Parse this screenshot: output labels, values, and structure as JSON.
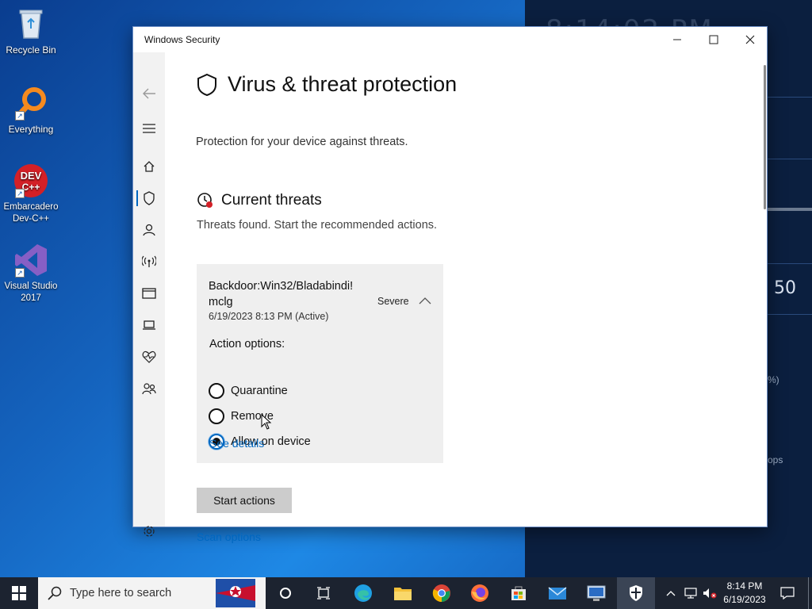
{
  "desktop": {
    "icons": [
      {
        "label": "Recycle Bin"
      },
      {
        "label": "Everything"
      },
      {
        "label": "Embarcadero Dev-C++"
      },
      {
        "label": "Visual Studio 2017"
      }
    ],
    "background_widget": {
      "value": "50",
      "small1": "%)",
      "small2": "ops"
    }
  },
  "window": {
    "title": "Windows Security",
    "controls": {
      "minimize": "—",
      "maximize": "☐",
      "close": "✕"
    }
  },
  "sidebar": {
    "items": [
      {
        "name": "back-icon"
      },
      {
        "name": "menu-icon"
      },
      {
        "name": "home-icon"
      },
      {
        "name": "shield-icon",
        "active": true
      },
      {
        "name": "account-icon"
      },
      {
        "name": "network-icon"
      },
      {
        "name": "app-browser-icon"
      },
      {
        "name": "device-icon"
      },
      {
        "name": "health-icon"
      },
      {
        "name": "family-icon"
      },
      {
        "name": "settings-icon"
      }
    ]
  },
  "main": {
    "title": "Virus & threat protection",
    "subtitle": "Protection for your device against threats.",
    "current_threats": {
      "title": "Current threats",
      "subtitle": "Threats found. Start the recommended actions."
    },
    "threat": {
      "name": "Backdoor:Win32/Bladabindi!mclg",
      "name_line1": "Backdoor:Win32/Bladabindi!",
      "name_line2": "mclg",
      "date": "6/19/2023 8:13 PM (Active)",
      "severity": "Severe",
      "action_label": "Action options:",
      "options": [
        {
          "label": "Quarantine",
          "checked": false
        },
        {
          "label": "Remove",
          "checked": false
        },
        {
          "label": "Allow on device",
          "checked": true
        }
      ],
      "see_details": "See details"
    },
    "start_actions": "Start actions",
    "scan_options": "Scan options"
  },
  "taskbar": {
    "search_placeholder": "Type here to search",
    "time": "8:14 PM",
    "date": "6/19/2023"
  },
  "colors": {
    "accent": "#0067c0",
    "desktop": "#1565c0",
    "taskbar": "#1c2330"
  }
}
